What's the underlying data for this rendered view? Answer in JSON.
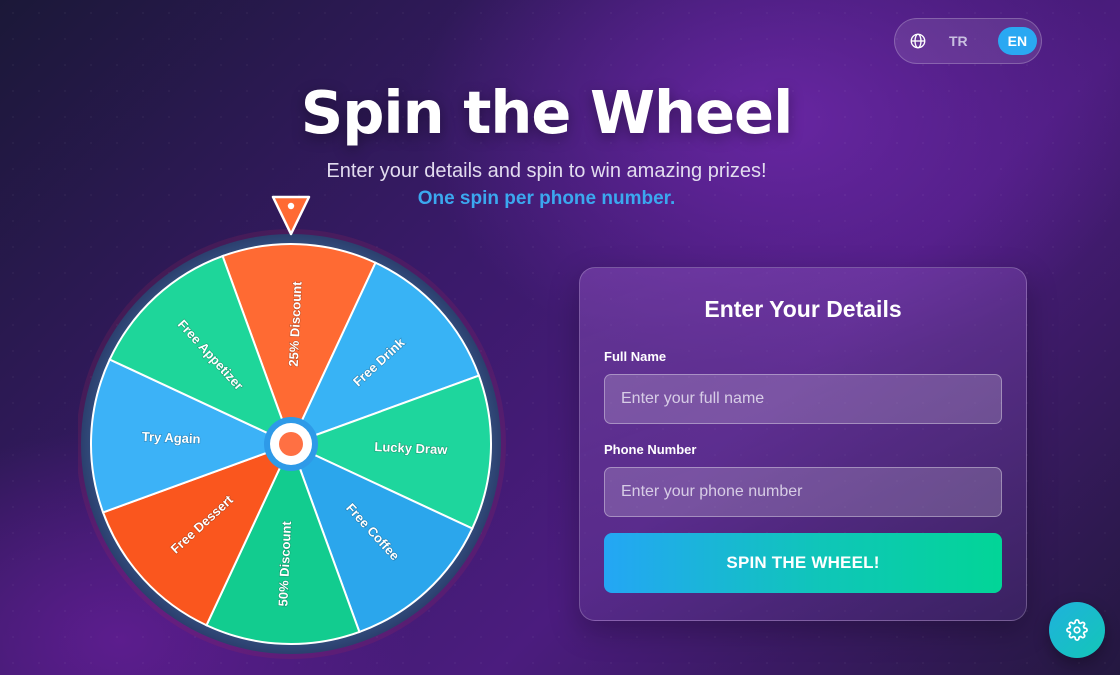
{
  "language_switch": {
    "icon": "globe-icon",
    "options": [
      "TR",
      "EN"
    ],
    "active": "EN",
    "active_color": "#2aa8f2"
  },
  "header": {
    "title": "Spin the Wheel",
    "subtitle": "Enter your details and spin to win amazing prizes!",
    "notice": "One spin per phone number."
  },
  "wheel": {
    "pointer_color": "#ff6a33",
    "center_dot_color": "#ff7043",
    "segments": [
      {
        "label": "25% Discount",
        "color": "#ff6a33"
      },
      {
        "label": "Free Drink",
        "color": "#38b3f5"
      },
      {
        "label": "Lucky Draw",
        "color": "#1ed69d"
      },
      {
        "label": "Free Coffee",
        "color": "#2ba6ec"
      },
      {
        "label": "50% Discount",
        "color": "#12cc8f"
      },
      {
        "label": "Free Dessert",
        "color": "#fa561e"
      },
      {
        "label": "Try Again",
        "color": "#3cb2f7"
      },
      {
        "label": "Free Appetizer",
        "color": "#1ed69a"
      }
    ]
  },
  "form": {
    "title": "Enter Your Details",
    "name_label": "Full Name",
    "name_placeholder": "Enter your full name",
    "phone_label": "Phone Number",
    "phone_placeholder": "Enter your phone number",
    "submit_label": "SPIN THE WHEEL!"
  },
  "settings": {
    "icon": "gear-icon"
  }
}
